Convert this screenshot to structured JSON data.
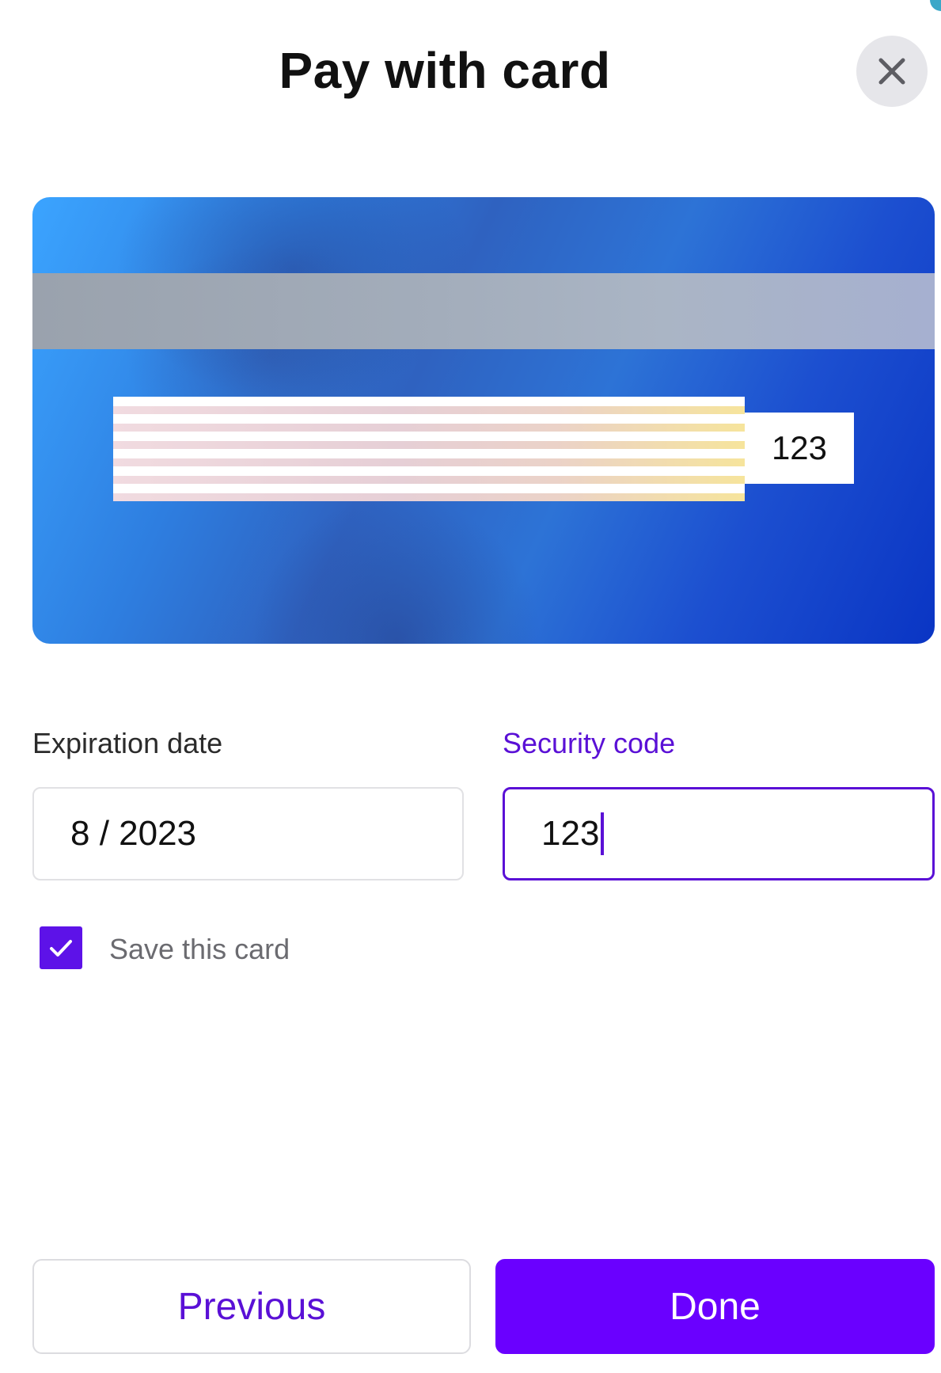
{
  "dialog": {
    "title": "Pay with card",
    "close_icon": "close-icon"
  },
  "card_preview": {
    "side": "back",
    "cvv_display": "123",
    "colors": {
      "base": "#2e7ee0",
      "deep": "#0a35c4",
      "stripe": "#a3adbb"
    }
  },
  "form": {
    "expiration": {
      "label": "Expiration date",
      "value": "8 / 2023"
    },
    "security_code": {
      "label": "Security code",
      "value": "123",
      "focused": true
    },
    "save_card": {
      "label": "Save this card",
      "checked": true,
      "icon": "check-icon"
    }
  },
  "actions": {
    "previous_label": "Previous",
    "done_label": "Done"
  },
  "colors": {
    "accent": "#5a10d6",
    "primary_button": "#6a00ff"
  }
}
